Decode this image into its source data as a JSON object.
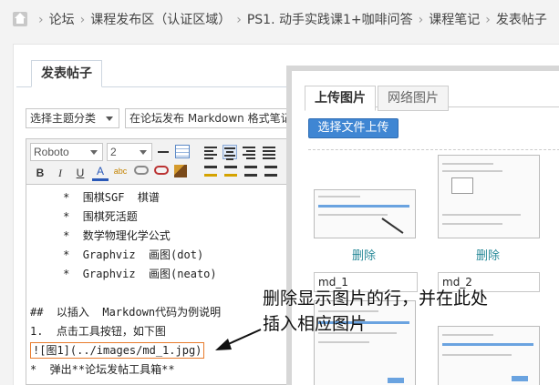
{
  "breadcrumb": {
    "items": [
      "论坛",
      "课程发布区（认证区域）",
      "PS1. 动手实践课1+咖啡问答",
      "课程笔记",
      "发表帖子"
    ]
  },
  "post_tab_label": "发表帖子",
  "form": {
    "topic_select": "选择主题分类",
    "title_value": "在论坛发布 Markdown 格式笔记教"
  },
  "toolbar": {
    "font": "Roboto",
    "size": "2",
    "bold": "B",
    "italic": "I",
    "underline": "U",
    "font_color": "A",
    "highlight": "abc"
  },
  "editor_lines": [
    "     *  围棋SGF  棋谱",
    "     *  围棋死活题",
    "     *  数学物理化学公式",
    "     *  Graphviz  画图(dot)",
    "     *  Graphviz  画图(neato)",
    "",
    "##  以插入  Markdown代码为例说明",
    "1.  点击工具按钮，如下图",
    "![图1](../images/md_1.jpg)",
    "*  弹出**论坛发帖工具箱**"
  ],
  "dialog": {
    "tab_upload": "上传图片",
    "tab_web": "网络图片",
    "upload_button": "选择文件上传",
    "delete_label_1": "删除",
    "delete_label_2": "删除",
    "name_1": "md_1",
    "name_2": "md_2"
  },
  "annotation": {
    "line1": "删除显示图片的行，并在此处",
    "line2": "插入相应图片"
  },
  "colors": {
    "accent_blue": "#3f86d3",
    "highlight_border": "#e87b2c",
    "link_teal": "#2a8a99"
  }
}
